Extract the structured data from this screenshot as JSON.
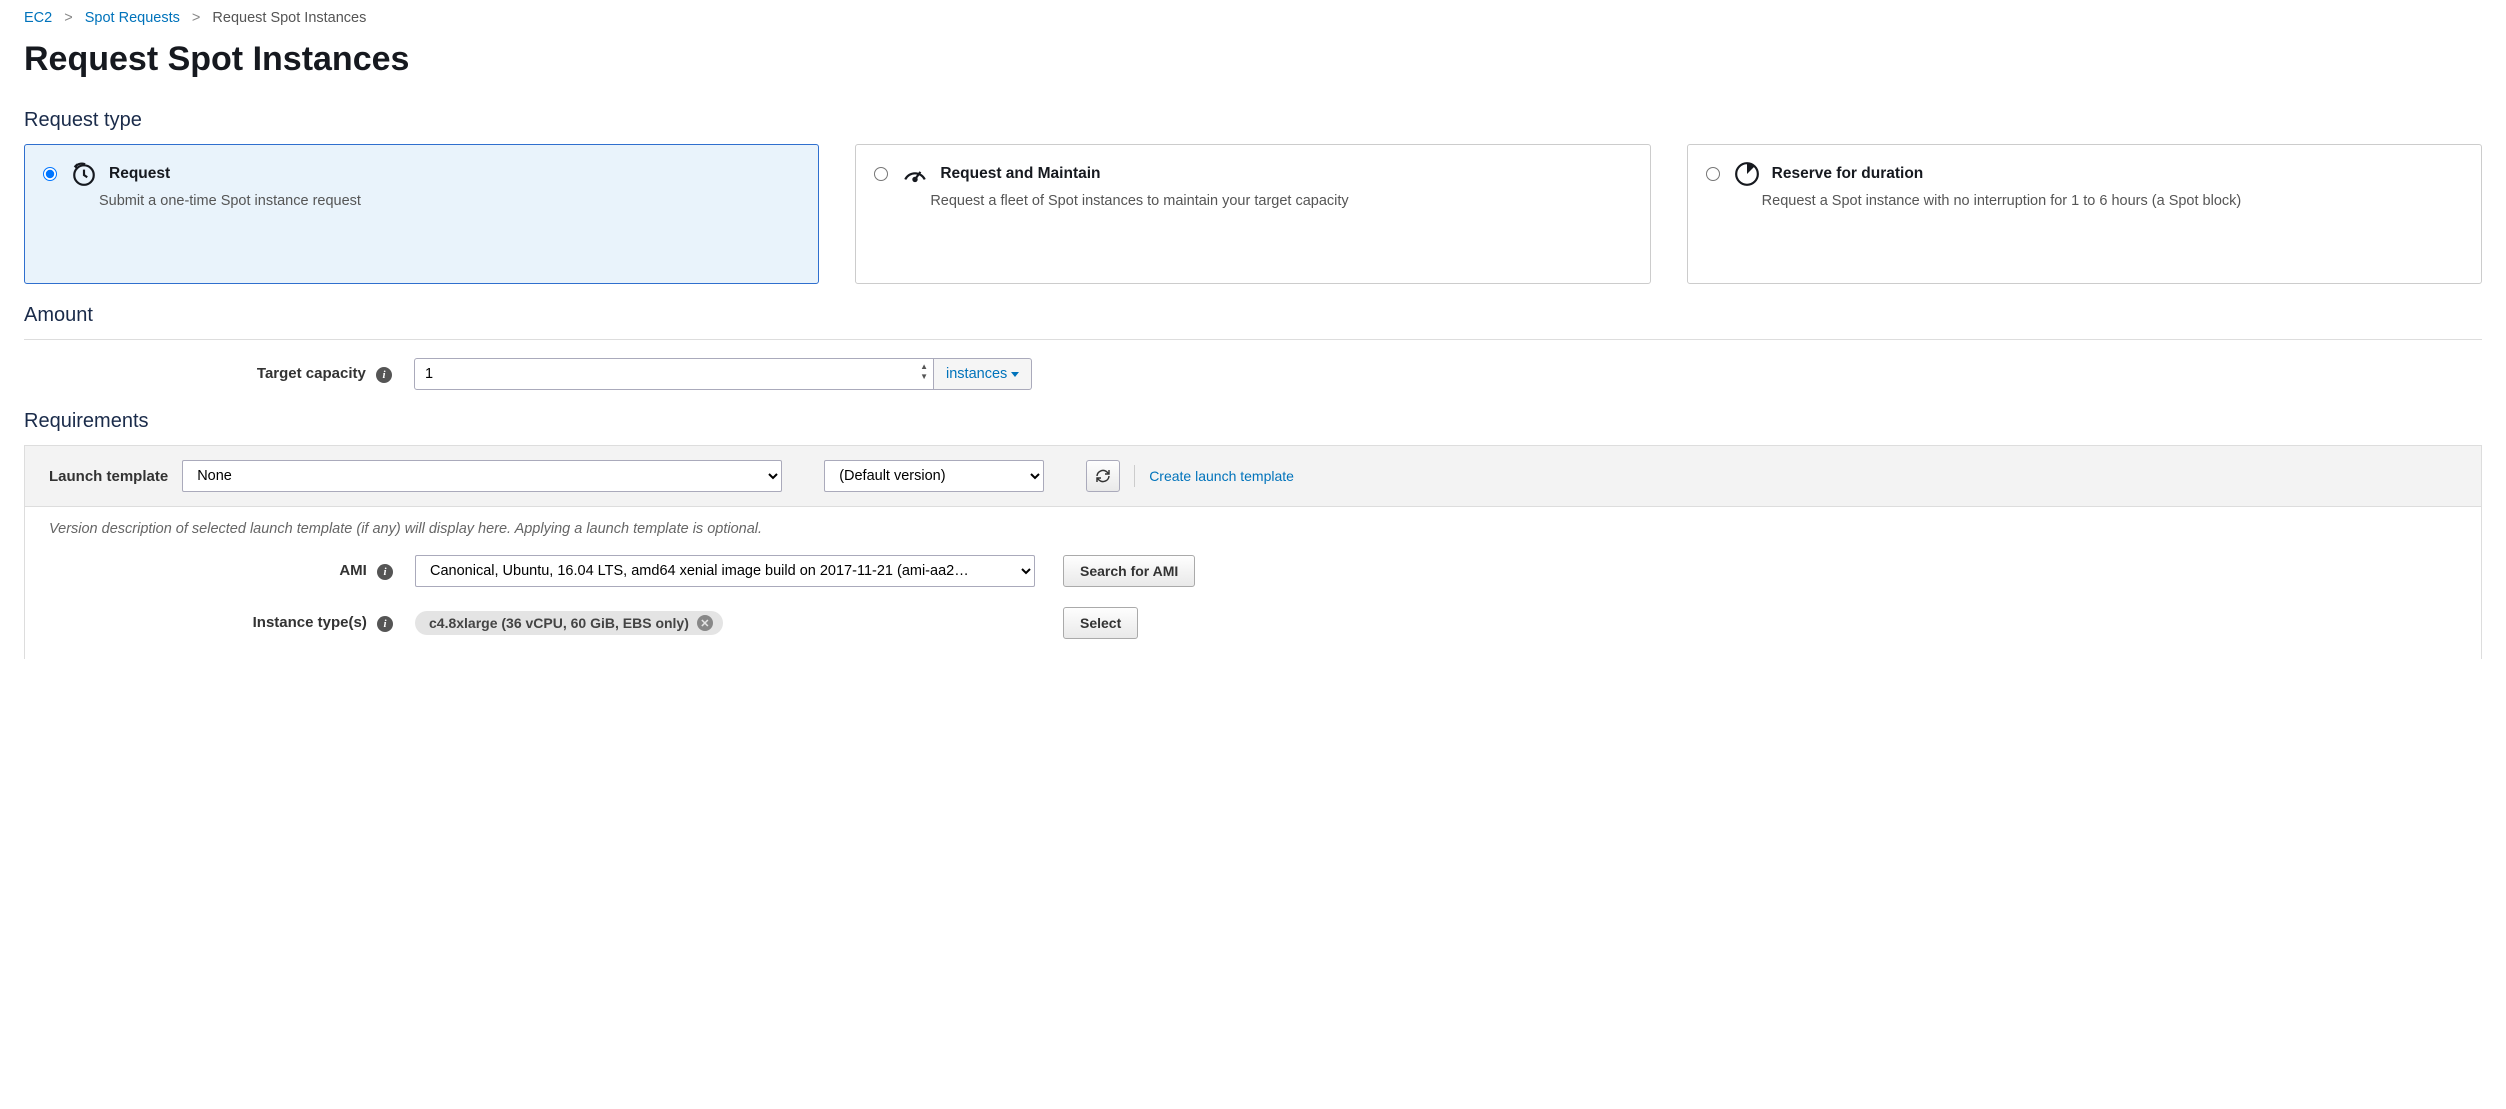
{
  "breadcrumb": {
    "items": [
      "EC2",
      "Spot Requests",
      "Request Spot Instances"
    ]
  },
  "page_title": "Request Spot Instances",
  "sections": {
    "request_type": {
      "heading": "Request type",
      "cards": [
        {
          "title": "Request",
          "desc": "Submit a one-time Spot instance request",
          "icon": "clock-refresh-icon",
          "selected": true
        },
        {
          "title": "Request and Maintain",
          "desc": "Request a fleet of Spot instances to maintain your target capacity",
          "icon": "gauge-icon",
          "selected": false
        },
        {
          "title": "Reserve for duration",
          "desc": "Request a Spot instance with no interruption for 1 to 6 hours (a Spot block)",
          "icon": "pie-clock-icon",
          "selected": false
        }
      ]
    },
    "amount": {
      "heading": "Amount",
      "target_capacity_label": "Target capacity",
      "target_capacity_value": "1",
      "unit_label": "instances"
    },
    "requirements": {
      "heading": "Requirements",
      "launch_template_label": "Launch template",
      "launch_template_value": "None",
      "version_value": "(Default version)",
      "create_link": "Create launch template",
      "desc": "Version description of selected launch template (if any) will display here. Applying a launch template is optional.",
      "ami_label": "AMI",
      "ami_value": "Canonical, Ubuntu, 16.04 LTS, amd64 xenial image build on 2017-11-21 (ami-aa2…",
      "search_ami_btn": "Search for AMI",
      "instance_types_label": "Instance type(s)",
      "instance_type_chip": "c4.8xlarge (36 vCPU, 60 GiB, EBS only)",
      "select_btn": "Select"
    }
  }
}
